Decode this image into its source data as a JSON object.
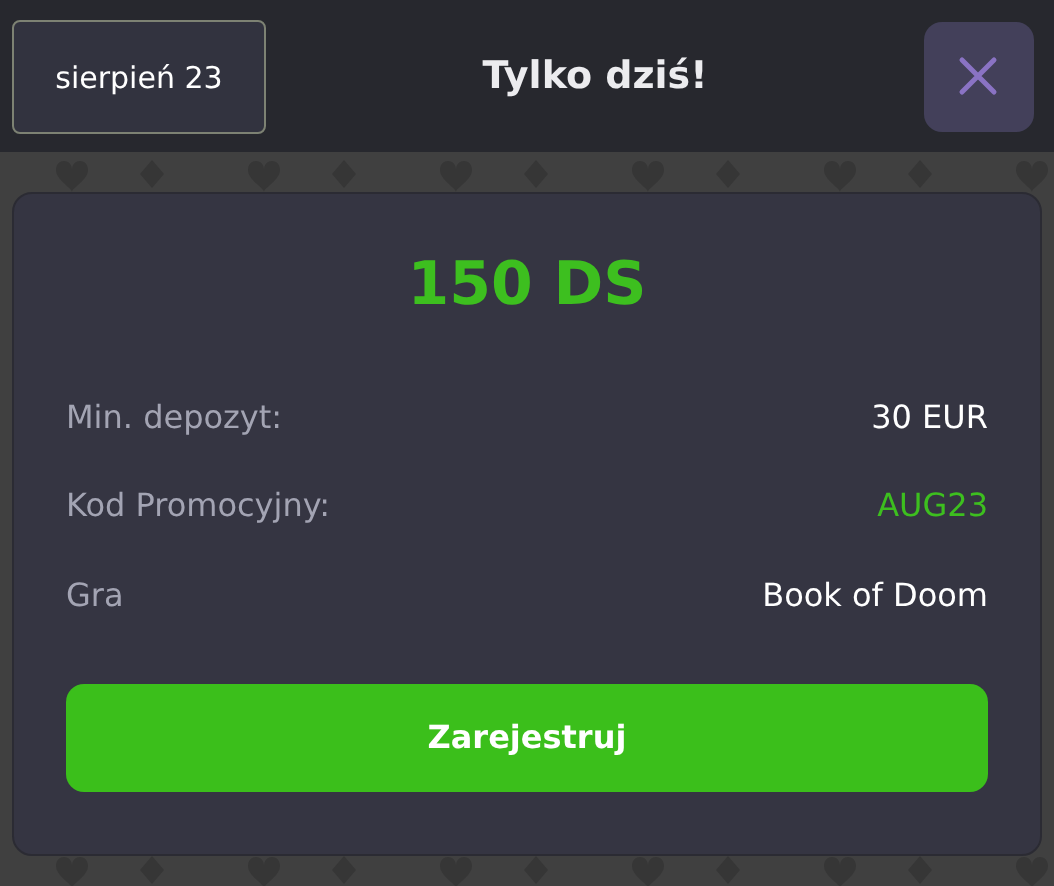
{
  "header": {
    "date_badge": "sierpień 23",
    "title": "Tylko dziś!"
  },
  "offer": {
    "amount": "150 DS",
    "details": [
      {
        "label": "Min. depozyt:",
        "value": "30 EUR",
        "color": "#ffffff"
      },
      {
        "label": "Kod Promocyjny:",
        "value": "AUG23",
        "color": "#3dbf1f"
      },
      {
        "label": "Gra",
        "value": "Book of Doom",
        "color": "#ffffff"
      }
    ],
    "button": "Zarejestruj"
  }
}
